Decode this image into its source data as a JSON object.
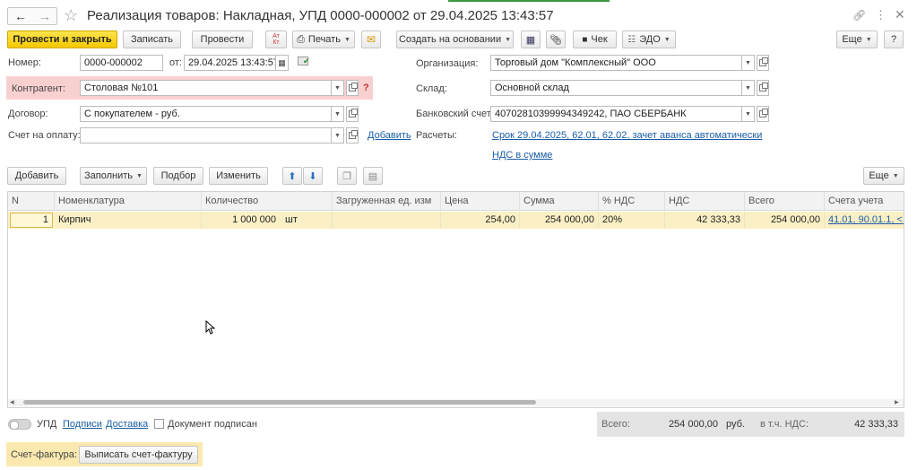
{
  "window": {
    "title": "Реализация товаров: Накладная, УПД 0000-000002 от 29.04.2025 13:43:57"
  },
  "toolbar": {
    "post_close": "Провести и закрыть",
    "save": "Записать",
    "post": "Провести",
    "print": "Печать",
    "create_based": "Создать на основании",
    "check": "Чек",
    "edo": "ЭДО",
    "more": "Еще",
    "help": "?"
  },
  "form": {
    "number_label": "Номер:",
    "number_value": "0000-000002",
    "date_label": "от:",
    "date_value": "29.04.2025 13:43:57",
    "counterparty_label": "Контрагент:",
    "counterparty_value": "Столовая №101",
    "contract_label": "Договор:",
    "contract_value": "С покупателем - руб.",
    "invoice_label": "Счет на оплату:",
    "invoice_value": "",
    "add_link": "Добавить",
    "org_label": "Организация:",
    "org_value": "Торговый дом \"Комплексный\" ООО",
    "warehouse_label": "Склад:",
    "warehouse_value": "Основной склад",
    "bank_label": "Банковский счет:",
    "bank_value": "40702810399994349242, ПАО СБЕРБАНК",
    "settlements_label": "Расчеты:",
    "settlements_link": "Срок 29.04.2025, 62.01, 62.02, зачет аванса автоматически",
    "vat_link": "НДС в сумме"
  },
  "table_toolbar": {
    "add": "Добавить",
    "fill": "Заполнить",
    "select": "Подбор",
    "change": "Изменить",
    "more": "Еще"
  },
  "table": {
    "headers": [
      "N",
      "Номенклатура",
      "Количество",
      "Загруженная ед. изм",
      "Цена",
      "Сумма",
      "% НДС",
      "НДС",
      "Всего",
      "Счета учета"
    ],
    "rows": [
      {
        "n": "1",
        "item": "Кирпич",
        "qty": "1 000 000",
        "unit": "шт",
        "loaded_unit": "",
        "price": "254,00",
        "sum": "254 000,00",
        "vat_rate": "20%",
        "vat": "42 333,33",
        "total": "254 000,00",
        "accounts": "41.01, 90.01.1, <..."
      }
    ]
  },
  "footer": {
    "upd_label": "УПД",
    "signatures_link": "Подписи",
    "delivery_link": "Доставка",
    "doc_signed_label": "Документ подписан",
    "total_label": "Всего:",
    "total_value": "254 000,00",
    "currency": "руб.",
    "vat_label": "в т.ч. НДС:",
    "vat_value": "42 333,33",
    "invoice_label": "Счет-фактура:",
    "issue_invoice": "Выписать счет-фактуру"
  },
  "colors": {
    "primary_button": "#f5c800",
    "required_highlight": "#f8d0d0",
    "selected_row": "#fbf0c5",
    "link": "#1a5da6",
    "totals_bg": "#e4e4e4",
    "invoice_panel": "#fbe9b0"
  }
}
